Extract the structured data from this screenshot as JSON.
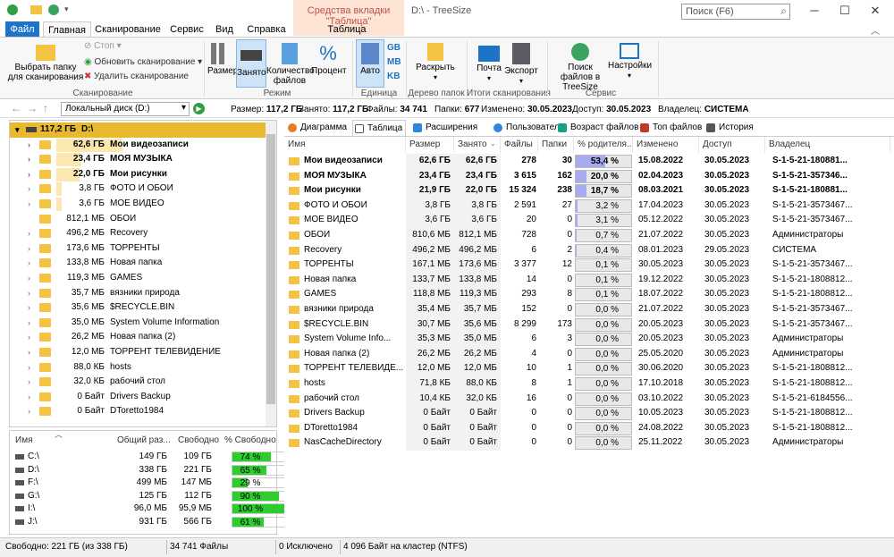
{
  "title": {
    "context_group": "Средства вкладки \"Таблица\"",
    "app": "D:\\ - TreeSize",
    "search_placeholder": "Поиск (F6)"
  },
  "ribbon_tabs": [
    "Файл",
    "Главная",
    "Сканирование",
    "Сервис",
    "Вид",
    "Справка",
    "Таблица"
  ],
  "ribbon": {
    "select_folder": "Выбрать папку для сканирования",
    "stop": "Стоп",
    "update_scan": "Обновить сканирование",
    "delete_scan": "Удалить сканирование",
    "group_scan": "Сканирование",
    "size": "Размер",
    "occupied": "Занято",
    "file_count": "Количество файлов",
    "percent": "Процент",
    "group_mode": "Режим",
    "auto": "Авто",
    "gb": "GB",
    "mb": "MB",
    "kb": "KB",
    "group_unit": "Единица",
    "expand": "Раскрыть",
    "group_tree": "Дерево папок",
    "mail": "Почта",
    "export": "Экспорт",
    "group_results": "Итоги сканирования",
    "search_files": "Поиск файлов в TreeSize",
    "settings": "Настройки",
    "group_service": "Сервис"
  },
  "addressbar": {
    "drive": "Локальный диск (D:)",
    "size_label": "Размер:",
    "size_val": "117,2 ГБ",
    "occ_label": "Занято:",
    "occ_val": "117,2 ГБ",
    "files_label": "Файлы:",
    "files_val": "34 741",
    "folders_label": "Папки:",
    "folders_val": "677",
    "changed_label": "Изменено:",
    "changed_val": "30.05.2023",
    "access_label": "Доступ:",
    "access_val": "30.05.2023",
    "owner_label": "Владелец:",
    "owner_val": "СИСТЕМА"
  },
  "tree": {
    "root": {
      "size": "117,2 ГБ",
      "name": "D:\\"
    },
    "items": [
      {
        "size": "62,6 ГБ",
        "name": "Мои видеозаписи",
        "bold": true,
        "pct": 1.0,
        "exp": true
      },
      {
        "size": "23,4 ГБ",
        "name": "МОЯ МУЗЫКА",
        "bold": true,
        "pct": 0.37,
        "exp": true
      },
      {
        "size": "22,0 ГБ",
        "name": "Мои рисунки",
        "bold": true,
        "pct": 0.35,
        "exp": true
      },
      {
        "size": "3,8 ГБ",
        "name": "ФОТО И ОБОИ",
        "pct": 0.06,
        "exp": true
      },
      {
        "size": "3,6 ГБ",
        "name": "МОЕ ВИДЕО",
        "pct": 0.06,
        "exp": true
      },
      {
        "size": "812,1 МБ",
        "name": "ОБОИ",
        "pct": 0,
        "exp": false
      },
      {
        "size": "496,2 МБ",
        "name": "Recovery",
        "pct": 0,
        "exp": true
      },
      {
        "size": "173,6 МБ",
        "name": "ТОРРЕНТЫ",
        "pct": 0,
        "exp": true
      },
      {
        "size": "133,8 МБ",
        "name": "Новая папка",
        "pct": 0,
        "exp": true
      },
      {
        "size": "119,3 МБ",
        "name": "GAMES",
        "pct": 0,
        "exp": true
      },
      {
        "size": "35,7 МБ",
        "name": "вязники природа",
        "pct": 0,
        "exp": true
      },
      {
        "size": "35,6 МБ",
        "name": "$RECYCLE.BIN",
        "pct": 0,
        "exp": true
      },
      {
        "size": "35,0 МБ",
        "name": "System Volume Information",
        "pct": 0,
        "exp": true
      },
      {
        "size": "26,2 МБ",
        "name": "Новая папка (2)",
        "pct": 0,
        "exp": true
      },
      {
        "size": "12,0 МБ",
        "name": "ТОРРЕНТ ТЕЛЕВИДЕНИЕ",
        "pct": 0,
        "exp": true
      },
      {
        "size": "88,0 КБ",
        "name": "hosts",
        "pct": 0,
        "exp": true
      },
      {
        "size": "32,0 КБ",
        "name": "рабочий стол",
        "pct": 0,
        "exp": true
      },
      {
        "size": "0 Байт",
        "name": "Drivers Backup",
        "pct": 0,
        "exp": true
      },
      {
        "size": "0 Байт",
        "name": "DToretto1984",
        "pct": 0,
        "exp": true
      }
    ]
  },
  "drives": {
    "headers": [
      "Имя",
      "Общий раз...",
      "Свободно",
      "% Свободно"
    ],
    "rows": [
      {
        "name": "C:\\",
        "total": "149 ГБ",
        "free": "109 ГБ",
        "pct": "74 %",
        "frac": 0.74
      },
      {
        "name": "D:\\",
        "total": "338 ГБ",
        "free": "221 ГБ",
        "pct": "65 %",
        "frac": 0.65
      },
      {
        "name": "F:\\",
        "total": "499 МБ",
        "free": "147 МБ",
        "pct": "29 %",
        "frac": 0.29
      },
      {
        "name": "G:\\",
        "total": "125 ГБ",
        "free": "112 ГБ",
        "pct": "90 %",
        "frac": 0.9
      },
      {
        "name": "I:\\",
        "total": "96,0 МБ",
        "free": "95,9 МБ",
        "pct": "100 %",
        "frac": 1.0
      },
      {
        "name": "J:\\",
        "total": "931 ГБ",
        "free": "566 ГБ",
        "pct": "61 %",
        "frac": 0.61
      }
    ]
  },
  "view_tabs": [
    "Диаграмма",
    "Таблица",
    "Расширения",
    "Пользователи",
    "Возраст файлов",
    "Топ файлов",
    "История"
  ],
  "table": {
    "headers": [
      "Имя",
      "Размер",
      "Занято",
      "Файлы",
      "Папки",
      "% родителя...",
      "Изменено",
      "Доступ",
      "Владелец"
    ],
    "rows": [
      {
        "name": "Мои видеозаписи",
        "size": "62,6 ГБ",
        "occ": "62,6 ГБ",
        "files": "278",
        "folders": "30",
        "pct": "53,4 %",
        "frac": 0.534,
        "mod": "15.08.2022",
        "acc": "30.05.2023",
        "owner": "S-1-5-21-180881...",
        "bold": true
      },
      {
        "name": "МОЯ МУЗЫКА",
        "size": "23,4 ГБ",
        "occ": "23,4 ГБ",
        "files": "3 615",
        "folders": "162",
        "pct": "20,0 %",
        "frac": 0.2,
        "mod": "02.04.2023",
        "acc": "30.05.2023",
        "owner": "S-1-5-21-357346...",
        "bold": true
      },
      {
        "name": "Мои рисунки",
        "size": "21,9 ГБ",
        "occ": "22,0 ГБ",
        "files": "15 324",
        "folders": "238",
        "pct": "18,7 %",
        "frac": 0.187,
        "mod": "08.03.2021",
        "acc": "30.05.2023",
        "owner": "S-1-5-21-180881...",
        "bold": true
      },
      {
        "name": "ФОТО И ОБОИ",
        "size": "3,8 ГБ",
        "occ": "3,8 ГБ",
        "files": "2 591",
        "folders": "27",
        "pct": "3,2 %",
        "frac": 0.032,
        "mod": "17.04.2023",
        "acc": "30.05.2023",
        "owner": "S-1-5-21-3573467..."
      },
      {
        "name": "МОЕ ВИДЕО",
        "size": "3,6 ГБ",
        "occ": "3,6 ГБ",
        "files": "20",
        "folders": "0",
        "pct": "3,1 %",
        "frac": 0.031,
        "mod": "05.12.2022",
        "acc": "30.05.2023",
        "owner": "S-1-5-21-3573467..."
      },
      {
        "name": "ОБОИ",
        "size": "810,6 МБ",
        "occ": "812,1 МБ",
        "files": "728",
        "folders": "0",
        "pct": "0,7 %",
        "frac": 0.007,
        "mod": "21.07.2022",
        "acc": "30.05.2023",
        "owner": "Администраторы"
      },
      {
        "name": "Recovery",
        "size": "496,2 МБ",
        "occ": "496,2 МБ",
        "files": "6",
        "folders": "2",
        "pct": "0,4 %",
        "frac": 0.004,
        "mod": "08.01.2023",
        "acc": "29.05.2023",
        "owner": "СИСТЕМА"
      },
      {
        "name": "ТОРРЕНТЫ",
        "size": "167,1 МБ",
        "occ": "173,6 МБ",
        "files": "3 377",
        "folders": "12",
        "pct": "0,1 %",
        "frac": 0.001,
        "mod": "30.05.2023",
        "acc": "30.05.2023",
        "owner": "S-1-5-21-3573467..."
      },
      {
        "name": "Новая папка",
        "size": "133,7 МБ",
        "occ": "133,8 МБ",
        "files": "14",
        "folders": "0",
        "pct": "0,1 %",
        "frac": 0.001,
        "mod": "19.12.2022",
        "acc": "30.05.2023",
        "owner": "S-1-5-21-1808812..."
      },
      {
        "name": "GAMES",
        "size": "118,8 МБ",
        "occ": "119,3 МБ",
        "files": "293",
        "folders": "8",
        "pct": "0,1 %",
        "frac": 0.001,
        "mod": "18.07.2022",
        "acc": "30.05.2023",
        "owner": "S-1-5-21-1808812..."
      },
      {
        "name": "вязники природа",
        "size": "35,4 МБ",
        "occ": "35,7 МБ",
        "files": "152",
        "folders": "0",
        "pct": "0,0 %",
        "frac": 0,
        "mod": "21.07.2022",
        "acc": "30.05.2023",
        "owner": "S-1-5-21-3573467..."
      },
      {
        "name": "$RECYCLE.BIN",
        "size": "30,7 МБ",
        "occ": "35,6 МБ",
        "files": "8 299",
        "folders": "173",
        "pct": "0,0 %",
        "frac": 0,
        "mod": "20.05.2023",
        "acc": "30.05.2023",
        "owner": "S-1-5-21-3573467..."
      },
      {
        "name": "System Volume Info...",
        "size": "35,3 МБ",
        "occ": "35,0 МБ",
        "files": "6",
        "folders": "3",
        "pct": "0,0 %",
        "frac": 0,
        "mod": "20.05.2023",
        "acc": "30.05.2023",
        "owner": "Администраторы"
      },
      {
        "name": "Новая папка (2)",
        "size": "26,2 МБ",
        "occ": "26,2 МБ",
        "files": "4",
        "folders": "0",
        "pct": "0,0 %",
        "frac": 0,
        "mod": "25.05.2020",
        "acc": "30.05.2023",
        "owner": "Администраторы"
      },
      {
        "name": "ТОРРЕНТ ТЕЛЕВИДЕ...",
        "size": "12,0 МБ",
        "occ": "12,0 МБ",
        "files": "10",
        "folders": "1",
        "pct": "0,0 %",
        "frac": 0,
        "mod": "30.06.2020",
        "acc": "30.05.2023",
        "owner": "S-1-5-21-1808812..."
      },
      {
        "name": "hosts",
        "size": "71,8 КБ",
        "occ": "88,0 КБ",
        "files": "8",
        "folders": "1",
        "pct": "0,0 %",
        "frac": 0,
        "mod": "17.10.2018",
        "acc": "30.05.2023",
        "owner": "S-1-5-21-1808812..."
      },
      {
        "name": "рабочий стол",
        "size": "10,4 КБ",
        "occ": "32,0 КБ",
        "files": "16",
        "folders": "0",
        "pct": "0,0 %",
        "frac": 0,
        "mod": "03.10.2022",
        "acc": "30.05.2023",
        "owner": "S-1-5-21-6184556..."
      },
      {
        "name": "Drivers Backup",
        "size": "0 Байт",
        "occ": "0 Байт",
        "files": "0",
        "folders": "0",
        "pct": "0,0 %",
        "frac": 0,
        "mod": "10.05.2023",
        "acc": "30.05.2023",
        "owner": "S-1-5-21-1808812..."
      },
      {
        "name": "DToretto1984",
        "size": "0 Байт",
        "occ": "0 Байт",
        "files": "0",
        "folders": "0",
        "pct": "0,0 %",
        "frac": 0,
        "mod": "24.08.2022",
        "acc": "30.05.2023",
        "owner": "S-1-5-21-1808812..."
      },
      {
        "name": "NasCacheDirectory",
        "size": "0 Байт",
        "occ": "0 Байт",
        "files": "0",
        "folders": "0",
        "pct": "0,0 %",
        "frac": 0,
        "mod": "25.11.2022",
        "acc": "30.05.2023",
        "owner": "Администраторы"
      }
    ]
  },
  "status": {
    "free": "Свободно: 221 ГБ  (из 338 ГБ)",
    "files": "34 741 Файлы",
    "excluded": "0 Исключено",
    "cluster": "4 096 Байт на кластер (NTFS)"
  },
  "colors": {
    "accent": "#1e72c8",
    "tree_bar": "#fbe7b0",
    "pct_bar": "#a9a9f0",
    "drive_bar": "#2ecc2e"
  }
}
